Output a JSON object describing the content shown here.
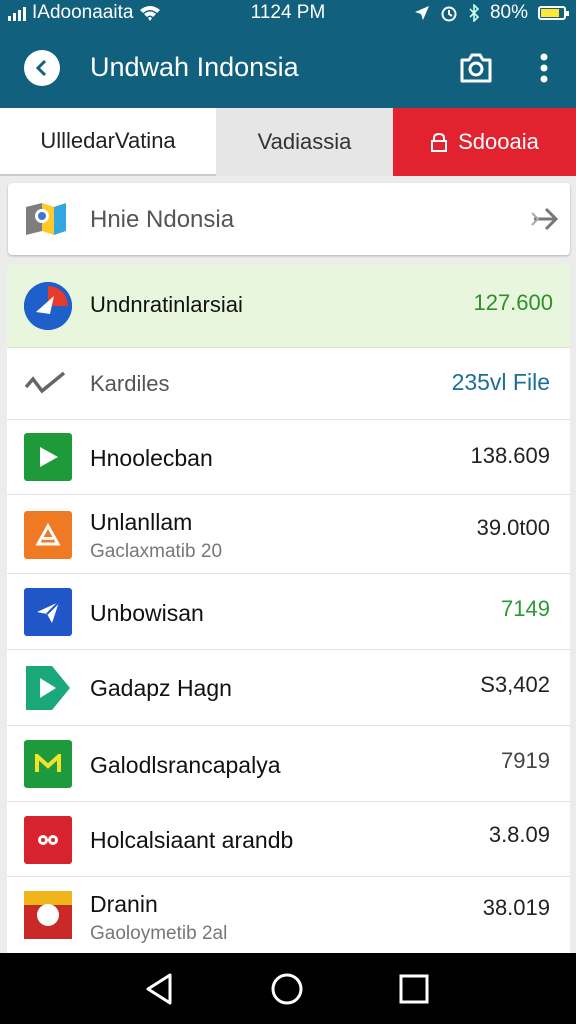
{
  "status_bar": {
    "carrier": "IAdoonaaita",
    "time": "1124 PM",
    "battery": "80%",
    "battery_level": 0.8
  },
  "app_bar": {
    "title": "Undwah Indonsia",
    "icons": [
      "back-icon",
      "camera-icon",
      "more-vert-icon"
    ]
  },
  "tabs": [
    {
      "label": "UllledarVatina"
    },
    {
      "label": "Vadiassia"
    },
    {
      "label": "Sdooaia"
    }
  ],
  "search_card": {
    "label": "Hnie Ndonsia",
    "icons": [
      "maps-logo-icon",
      "forward-arrow-icon"
    ]
  },
  "highlight_row": {
    "name": "Undnratinlarsiai",
    "value": "127.600",
    "colors": {
      "bg": "#e8f6de",
      "value": "#2f8f2a"
    }
  },
  "files_row": {
    "name": "Kardiles",
    "value": "235vl File"
  },
  "rows": [
    {
      "name": "Hnoolecban",
      "sub": "",
      "value": "138.609",
      "icon": "play-store-icon",
      "icon_color": "#1f9a3a",
      "value_color": "#222222"
    },
    {
      "name": "Unlanllam",
      "sub": "Gaclaxmatib 20",
      "value": "39.0t00",
      "icon": "warning-triangle-icon",
      "icon_color": "#f07a23",
      "value_color": "#222222"
    },
    {
      "name": "Unbowisan",
      "sub": "",
      "value": "7149",
      "icon": "paper-plane-icon",
      "icon_color": "#2156c8",
      "value_color": "#2b9a34"
    },
    {
      "name": "Gadapz Hagn",
      "sub": "",
      "value": "S3,402",
      "icon": "play-arrow-icon",
      "icon_color": "#1aa87a",
      "value_color": "#222222"
    },
    {
      "name": "Galodlsrancapalya",
      "sub": "",
      "value": "7919",
      "icon": "m-logo-icon",
      "icon_color": "#1c9a3d",
      "value_color": "#444444"
    },
    {
      "name": "Holcalsiaant arandb",
      "sub": "",
      "value": "3.8.09",
      "icon": "record-icon",
      "icon_color": "#d8232e",
      "value_color": "#222222"
    },
    {
      "name": "Dranin",
      "sub": "Gaoloymetib 2al",
      "value": "38.019",
      "icon": "disc-icon",
      "icon_color": "#c92a27",
      "value_color": "#222222"
    }
  ],
  "nav_bar": {
    "icons": [
      "back-triangle-icon",
      "home-circle-icon",
      "recents-square-icon"
    ]
  }
}
